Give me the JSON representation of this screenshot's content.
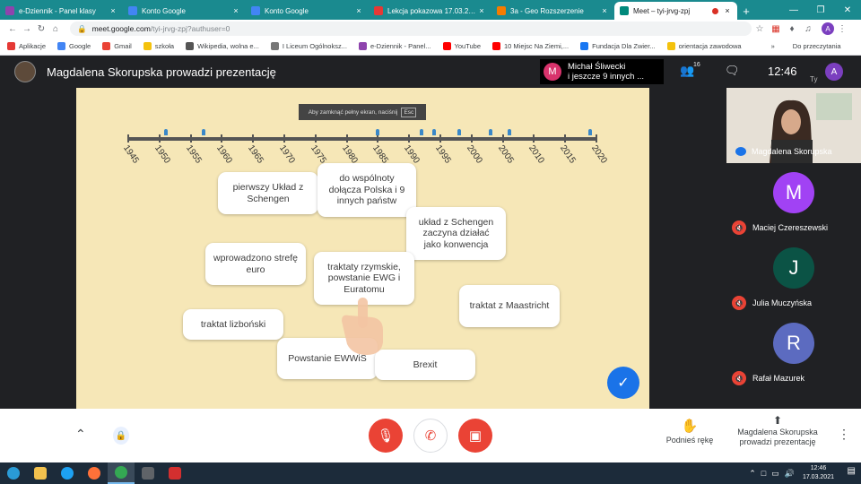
{
  "browser": {
    "tabs": [
      {
        "title": "e-Dziennik - Panel klasy",
        "icon_color": "#8e44ad",
        "active": false
      },
      {
        "title": "Konto Google",
        "icon_color": "#4285f4",
        "active": false
      },
      {
        "title": "Konto Google",
        "icon_color": "#4285f4",
        "active": false
      },
      {
        "title": "Lekcja pokazowa 17.03.2021",
        "icon_color": "#e53935",
        "active": false
      },
      {
        "title": "3a - Geo Rozszerzenie",
        "icon_color": "#f57c00",
        "active": false
      },
      {
        "title": "Meet – tyi-jrvg-zpj",
        "icon_color": "#00897b",
        "active": true
      }
    ],
    "new_tab_label": "+",
    "url_host": "meet.google.com",
    "url_path": "/tyi-jrvg-zpj?authuser=0",
    "profile_initial": "A",
    "bookmarks": [
      {
        "label": "Aplikacje",
        "color": "#e53935"
      },
      {
        "label": "Google",
        "color": "#4285f4"
      },
      {
        "label": "Gmail",
        "color": "#ea4335"
      },
      {
        "label": "szkoła",
        "color": "#f4c20d"
      },
      {
        "label": "Wikipedia, wolna e...",
        "color": "#555555"
      },
      {
        "label": "I Liceum Ogólnoksz...",
        "color": "#777777"
      },
      {
        "label": "e-Dziennik - Panel...",
        "color": "#8e44ad"
      },
      {
        "label": "YouTube",
        "color": "#ff0000"
      },
      {
        "label": "10 Miejsc Na Ziemi,...",
        "color": "#ff0000"
      },
      {
        "label": "Fundacja Dla Zwier...",
        "color": "#1877f2"
      },
      {
        "label": "orientacja zawodowa",
        "color": "#f4c20d"
      }
    ],
    "bookmarks_more": "»",
    "bookmarks_reading": "Do przeczytania"
  },
  "meet": {
    "presentation_title": "Magdalena Skorupska prowadzi prezentację",
    "notification_initial": "M",
    "notification_line1": "Michał Śliwecki",
    "notification_line2": "i jeszcze 9 innych ...",
    "participants_count": "16",
    "clock": "12:46",
    "self_initial": "A",
    "self_label": "Ty"
  },
  "slide": {
    "esc_hint": "Aby zamknąć pełny ekran, naciśnij",
    "esc_key": "Esc",
    "years": [
      "1945",
      "1950",
      "1955",
      "1960",
      "1965",
      "1970",
      "1975",
      "1980",
      "1985",
      "1990",
      "1995",
      "2000",
      "2005",
      "2010",
      "2015",
      "2020"
    ],
    "pin_years": [
      1951,
      1957,
      1985,
      1992,
      1994,
      1998,
      2003,
      2006,
      2019
    ],
    "cards": [
      {
        "text": "pierwszy Układ z Schengen"
      },
      {
        "text": "do wspólnoty dołącza Polska i 9 innych państw"
      },
      {
        "text": "układ z Schengen zaczyna działać jako konwencja"
      },
      {
        "text": "wprowadzono strefę euro"
      },
      {
        "text": "traktaty rzymskie, powstanie EWG i Euratomu"
      },
      {
        "text": "traktat z Maastricht"
      },
      {
        "text": "traktat lizboński"
      },
      {
        "text": "Powstanie EWWiS"
      },
      {
        "text": "Brexit"
      }
    ]
  },
  "participants": [
    {
      "name": "Magdalena Skorupska",
      "type": "video"
    },
    {
      "name": "Maciej Czereszewski",
      "initial": "M",
      "color": "#a142f4",
      "muted": true
    },
    {
      "name": "Julia Muczyńska",
      "initial": "J",
      "color": "#0b5345",
      "muted": true
    },
    {
      "name": "Rafał Mazurek",
      "initial": "R",
      "color": "#5c6bc0",
      "muted": true
    }
  ],
  "controls": {
    "raise_hand": "Podnieś rękę",
    "presenting_line1": "Magdalena Skorupska",
    "presenting_line2": "prowadzi prezentację"
  },
  "taskbar": {
    "time": "12:46",
    "date": "17.03.2021",
    "apps": [
      {
        "name": "start",
        "color": "#2a9bd6"
      },
      {
        "name": "file-explorer",
        "color": "#f2c14e"
      },
      {
        "name": "edge",
        "color": "#1da1f2"
      },
      {
        "name": "firefox",
        "color": "#ff7139"
      },
      {
        "name": "chrome",
        "color": "#34a853"
      },
      {
        "name": "calculator",
        "color": "#5f6368"
      },
      {
        "name": "app-red",
        "color": "#d32f2f"
      }
    ]
  }
}
